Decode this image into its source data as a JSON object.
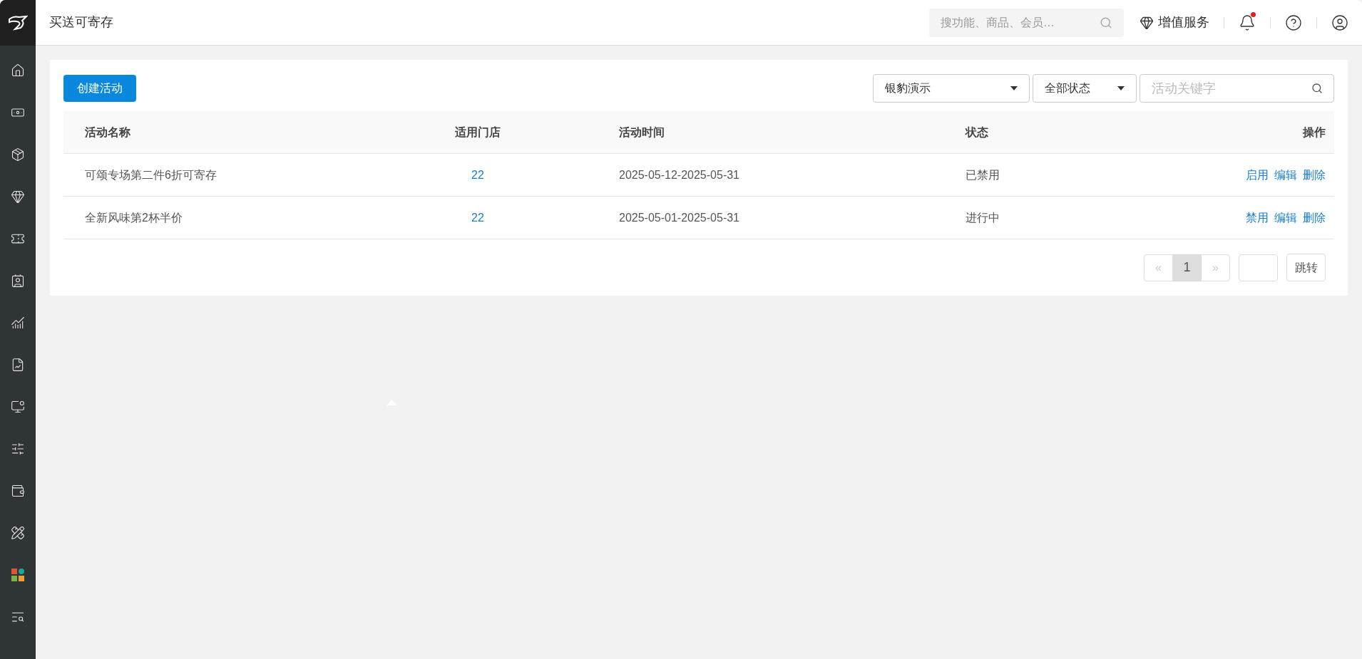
{
  "header": {
    "title": "买送可寄存",
    "search": {
      "placeholder": "搜功能、商品、会员…"
    },
    "value_added": "增值服务",
    "notifications": {
      "unread": true
    }
  },
  "toolbar": {
    "create_button": "创建活动",
    "store_select": "银豹演示",
    "status_select": "全部状态",
    "keyword": {
      "placeholder": "活动关键字"
    }
  },
  "table": {
    "columns": [
      "活动名称",
      "适用门店",
      "活动时间",
      "状态",
      "操作"
    ],
    "rows": [
      {
        "name": "可颂专场第二件6折可寄存",
        "stores": "22",
        "time": "2025-05-12-2025-05-31",
        "status": "已禁用",
        "actions": [
          "启用",
          "编辑",
          "删除"
        ]
      },
      {
        "name": "全新风味第2杯半价",
        "stores": "22",
        "time": "2025-05-01-2025-05-31",
        "status": "进行中",
        "actions": [
          "禁用",
          "编辑",
          "删除"
        ]
      }
    ]
  },
  "pagination": {
    "prev": "«",
    "pages": [
      {
        "label": "1",
        "selected": true
      }
    ],
    "next": "»",
    "jump": "跳转"
  }
}
